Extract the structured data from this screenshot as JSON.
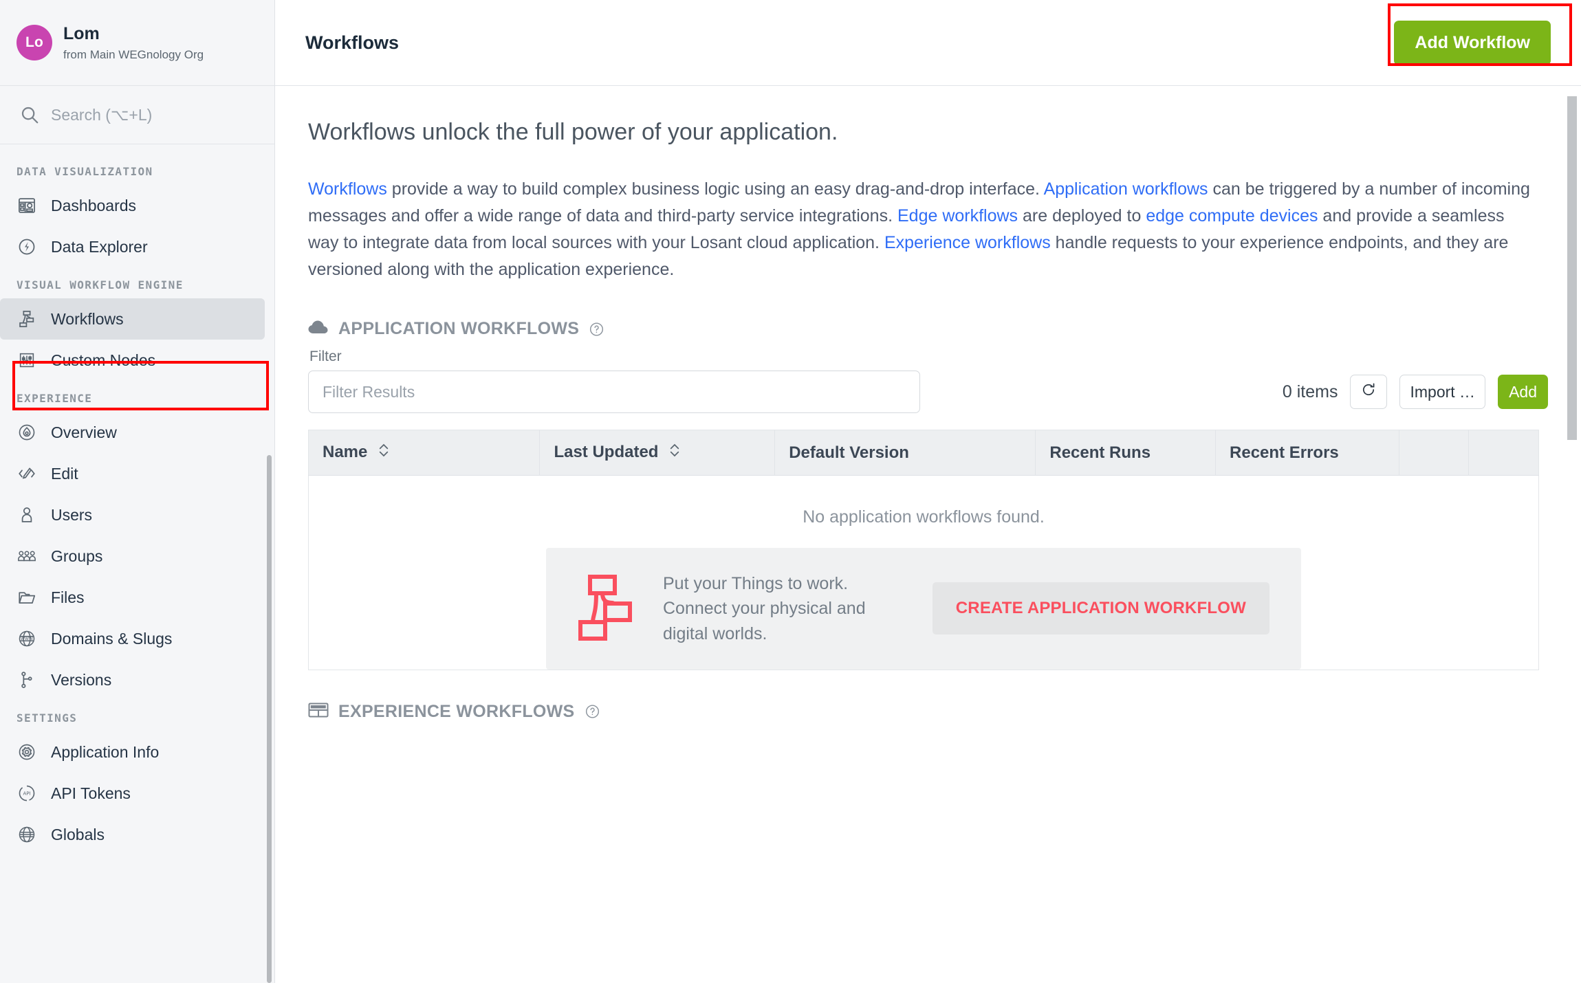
{
  "sidebar": {
    "org": {
      "avatar_initials": "Lo",
      "name": "Lom",
      "subtitle": "from Main WEGnology Org",
      "avatar_color": "#c944b0"
    },
    "search": {
      "placeholder": "Search (⌥+L)",
      "icon": "search-icon"
    },
    "groups": [
      {
        "title": "DATA VISUALIZATION",
        "items": [
          {
            "label": "Dashboards",
            "icon": "dashboard-icon",
            "active": false
          },
          {
            "label": "Data Explorer",
            "icon": "data-explorer-icon",
            "active": false
          }
        ]
      },
      {
        "title": "VISUAL WORKFLOW ENGINE",
        "items": [
          {
            "label": "Workflows",
            "icon": "workflow-icon",
            "active": true
          },
          {
            "label": "Custom Nodes",
            "icon": "sliders-icon",
            "active": false
          }
        ]
      },
      {
        "title": "EXPERIENCE",
        "items": [
          {
            "label": "Overview",
            "icon": "droplet-icon",
            "active": false
          },
          {
            "label": "Edit",
            "icon": "code-pencil-icon",
            "active": false
          },
          {
            "label": "Users",
            "icon": "user-icon",
            "active": false
          },
          {
            "label": "Groups",
            "icon": "users-group-icon",
            "active": false
          },
          {
            "label": "Files",
            "icon": "folder-icon",
            "active": false
          },
          {
            "label": "Domains & Slugs",
            "icon": "www-globe-icon",
            "active": false
          },
          {
            "label": "Versions",
            "icon": "branch-icon",
            "active": false
          }
        ]
      },
      {
        "title": "SETTINGS",
        "items": [
          {
            "label": "Application Info",
            "icon": "gear-icon",
            "active": false
          },
          {
            "label": "API Tokens",
            "icon": "api-icon",
            "active": false
          },
          {
            "label": "Globals",
            "icon": "globe-icon",
            "active": false
          }
        ]
      }
    ]
  },
  "header": {
    "title": "Workflows",
    "add_workflow_label": "Add Workflow",
    "add_workflow_color": "#7cb518"
  },
  "main": {
    "lede": "Workflows unlock the full power of your application.",
    "paragraph": {
      "link1": "Workflows",
      "t1": " provide a way to build complex business logic using an easy drag-and-drop interface. ",
      "link2": "Application workflows",
      "t2": " can be triggered by a number of incoming messages and offer a wide range of data and third-party service integrations. ",
      "link3": "Edge workflows",
      "t3": " are deployed to ",
      "link4": "edge compute devices",
      "t4": " and provide a seamless way to integrate data from local sources with your Losant cloud application. ",
      "link5": "Experience workflows",
      "t5": " handle requests to your experience endpoints, and they are versioned along with the application experience.",
      "link_color": "#2f6df6"
    },
    "application_section": {
      "icon": "cloud-icon",
      "title": "APPLICATION WORKFLOWS",
      "help_icon": "help-circle-icon",
      "filter_label": "Filter",
      "filter_placeholder": "Filter Results",
      "filter_value": "",
      "items_count": "0 items",
      "refresh_icon": "refresh-icon",
      "import_label": "Import …",
      "add_label": "Add",
      "columns": [
        "Name",
        "Last Updated",
        "Default Version",
        "Recent Runs",
        "Recent Errors",
        "",
        ""
      ],
      "sortable": [
        true,
        true,
        false,
        false,
        false,
        false,
        false
      ],
      "empty_message": "No application workflows found.",
      "promo": {
        "icon": "workflow-red-icon",
        "text": "Put your Things to work. Connect your physical and digital worlds.",
        "button_label": "CREATE APPLICATION WORKFLOW",
        "button_color": "#fa4f5e"
      }
    },
    "experience_section": {
      "icon": "experience-icon",
      "title": "EXPERIENCE WORKFLOWS",
      "help_icon": "help-circle-icon"
    }
  }
}
